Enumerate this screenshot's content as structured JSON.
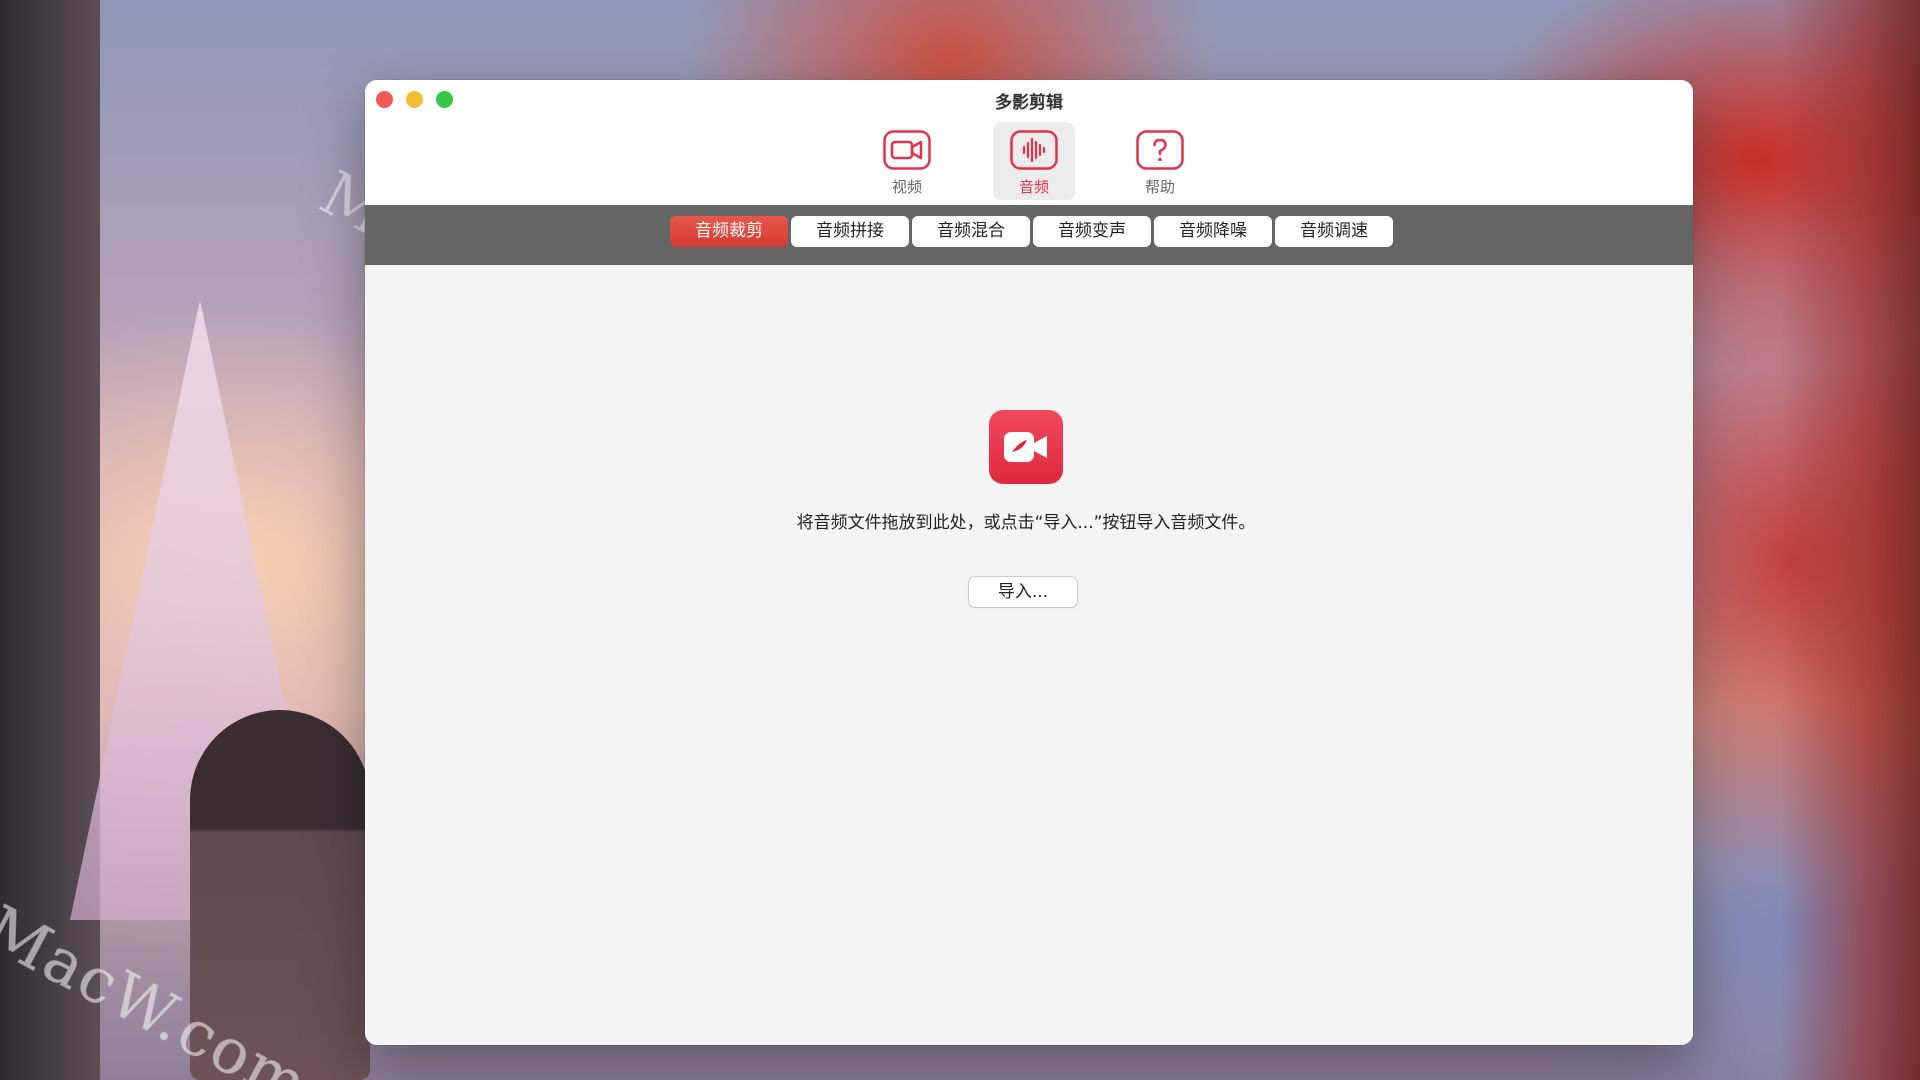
{
  "window": {
    "title": "多影剪辑"
  },
  "toolbar": {
    "items": [
      {
        "label": "视频",
        "icon": "video-camera-icon",
        "selected": false
      },
      {
        "label": "音频",
        "icon": "audio-waveform-icon",
        "selected": true
      },
      {
        "label": "帮助",
        "icon": "help-question-icon",
        "selected": false
      }
    ]
  },
  "segments": {
    "items": [
      {
        "label": "音频裁剪",
        "active": true
      },
      {
        "label": "音频拼接",
        "active": false
      },
      {
        "label": "音频混合",
        "active": false
      },
      {
        "label": "音频变声",
        "active": false
      },
      {
        "label": "音频降噪",
        "active": false
      },
      {
        "label": "音频调速",
        "active": false
      }
    ]
  },
  "content": {
    "app_icon": "video-recorder-icon",
    "drop_hint": "将音频文件拖放到此处，或点击“导入...”按钮导入音频文件。",
    "import_button": "导入..."
  },
  "desktop": {
    "watermark_text": "MacW.com"
  },
  "colors": {
    "accent": "#e2324a",
    "segment_active": "#d63a33",
    "segment_bar": "#656565",
    "close": "#ee5a52",
    "minimize": "#f5bd31",
    "maximize": "#34c846"
  }
}
